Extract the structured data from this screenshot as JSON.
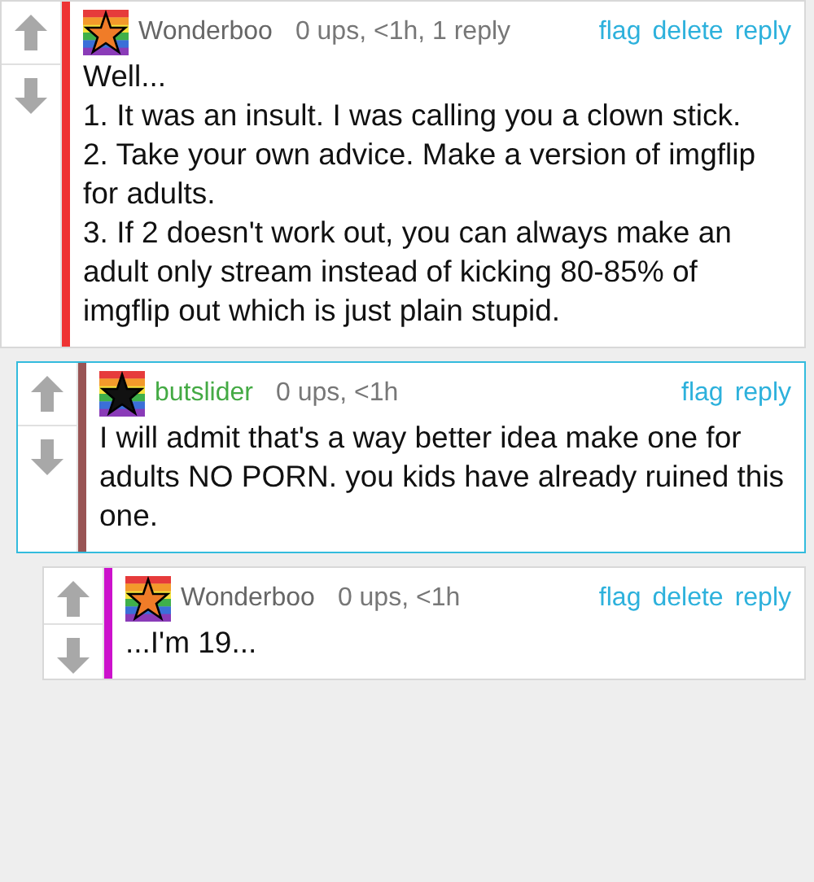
{
  "comments": [
    {
      "author": {
        "name": "Wonderboo",
        "color": "#666666"
      },
      "avatar": {
        "color": "#f07c28"
      },
      "color": "#ee3333",
      "highlighted": false,
      "meta": "0 ups, <1h, 1 reply",
      "actions": [
        "flag",
        "delete",
        "reply"
      ],
      "paragraphs": [
        "Well...",
        "1. It was an insult. I was calling you a clown stick.",
        "2. Take your own advice. Make a version of imgflip for adults.",
        "3. If 2 doesn't work out, you can always make an adult only stream instead of kicking 80-85% of imgflip out which is just plain stupid."
      ],
      "children": [
        {
          "author": {
            "name": "butslider",
            "color": "#44aa44"
          },
          "avatar": {
            "color": "#111111"
          },
          "color": "#995555",
          "highlighted": true,
          "meta": "0 ups, <1h",
          "actions": [
            "flag",
            "reply"
          ],
          "paragraphs": [
            "I will admit that's a way better idea make one for adults NO PORN. you kids have already ruined this one."
          ],
          "children": [
            {
              "author": {
                "name": "Wonderboo",
                "color": "#666666"
              },
              "avatar": {
                "color": "#f07c28"
              },
              "color": "#cc11cc",
              "highlighted": false,
              "meta": "0 ups, <1h",
              "actions": [
                "flag",
                "delete",
                "reply"
              ],
              "paragraphs": [
                "...I'm 19..."
              ]
            }
          ]
        }
      ]
    }
  ]
}
